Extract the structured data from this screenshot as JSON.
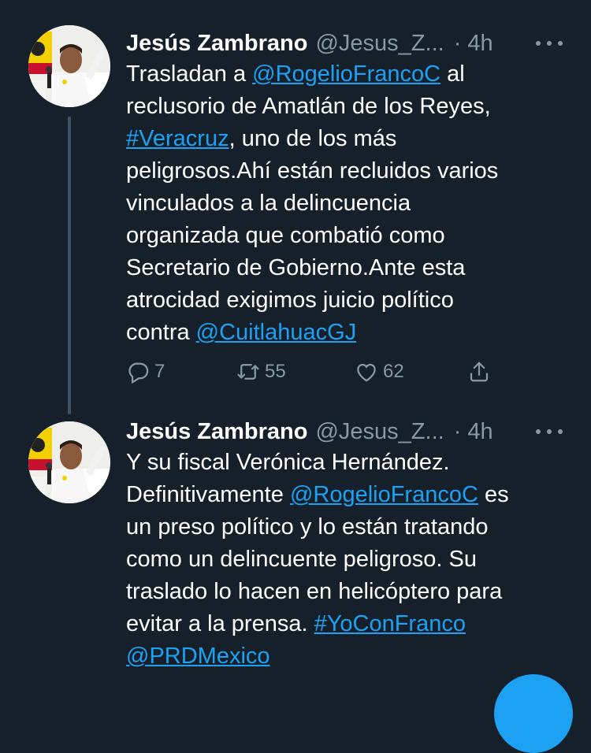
{
  "tweets": [
    {
      "author": {
        "name": "Jesús Zambrano",
        "handle": "@Jesus_Z...",
        "time": "· 4h"
      },
      "lines": [
        [
          {
            "t": "Trasladan a "
          },
          {
            "t": "@RogelioFrancoC",
            "link": true
          },
          {
            "t": " al"
          }
        ],
        [
          {
            "t": "reclusorio de Amatlán de los Reyes,"
          }
        ],
        [
          {
            "t": "#Veracruz",
            "link": true
          },
          {
            "t": ", uno de los más"
          }
        ],
        [
          {
            "t": "peligrosos.Ahí están recluidos varios"
          }
        ],
        [
          {
            "t": "vinculados a la delincuencia"
          }
        ],
        [
          {
            "t": "organizada que combatió como"
          }
        ],
        [
          {
            "t": "Secretario de Gobierno.Ante esta"
          }
        ],
        [
          {
            "t": "atrocidad exigimos juicio político"
          }
        ],
        [
          {
            "t": "contra "
          },
          {
            "t": "@CuitlahuacGJ",
            "link": true
          }
        ]
      ],
      "replies": "7",
      "retweets": "55",
      "likes": "62"
    },
    {
      "author": {
        "name": "Jesús Zambrano",
        "handle": "@Jesus_Z...",
        "time": "· 4h"
      },
      "lines": [
        [
          {
            "t": "Y su fiscal Verónica Hernández."
          }
        ],
        [
          {
            "t": "Definitivamente "
          },
          {
            "t": "@RogelioFrancoC",
            "link": true
          },
          {
            "t": " es"
          }
        ],
        [
          {
            "t": "un preso político y lo están tratando"
          }
        ],
        [
          {
            "t": "como un delincuente peligroso. Su"
          }
        ],
        [
          {
            "t": "traslado lo hacen en helicóptero para"
          }
        ],
        [
          {
            "t": "evitar a la prensa. "
          },
          {
            "t": "#YoConFranco",
            "link": true
          }
        ],
        [
          {
            "t": "@PRDMexico",
            "link": true
          }
        ]
      ]
    }
  ],
  "colors": {
    "background": "#15202b",
    "link": "#1da1f2",
    "muted": "#8899a6"
  },
  "icons": [
    "reply-icon",
    "retweet-icon",
    "like-icon",
    "share-icon",
    "more-icon"
  ]
}
